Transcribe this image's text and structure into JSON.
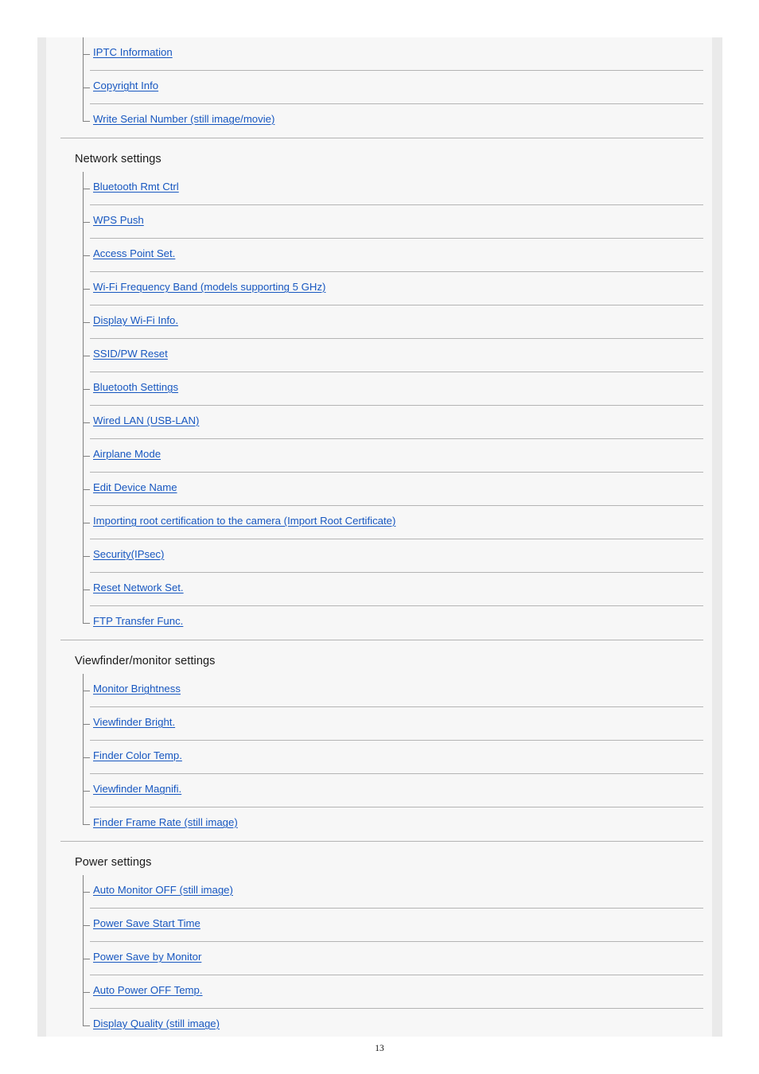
{
  "document": {
    "page_number": "13",
    "link_color": "#1757c0",
    "rule_color": "#b4b4b4",
    "page_background": "#f7f7f7"
  },
  "sections": [
    {
      "title": null,
      "items": [
        {
          "label": "IPTC Information"
        },
        {
          "label": "Copyright Info"
        },
        {
          "label": "Write Serial Number (still image/movie)"
        }
      ]
    },
    {
      "title": "Network settings",
      "items": [
        {
          "label": "Bluetooth Rmt Ctrl"
        },
        {
          "label": "WPS Push"
        },
        {
          "label": "Access Point Set."
        },
        {
          "label": "Wi-Fi Frequency Band (models supporting 5 GHz)"
        },
        {
          "label": "Display Wi-Fi Info."
        },
        {
          "label": "SSID/PW Reset"
        },
        {
          "label": "Bluetooth Settings"
        },
        {
          "label": "Wired LAN (USB-LAN)"
        },
        {
          "label": "Airplane Mode"
        },
        {
          "label": "Edit Device Name"
        },
        {
          "label": "Importing root certification to the camera (Import Root Certificate)"
        },
        {
          "label": "Security(IPsec)"
        },
        {
          "label": "Reset Network Set."
        },
        {
          "label": "FTP Transfer Func."
        }
      ]
    },
    {
      "title": "Viewfinder/monitor settings",
      "items": [
        {
          "label": "Monitor Brightness"
        },
        {
          "label": "Viewfinder Bright."
        },
        {
          "label": "Finder Color Temp."
        },
        {
          "label": "Viewfinder Magnifi."
        },
        {
          "label": "Finder Frame Rate (still image)"
        }
      ]
    },
    {
      "title": "Power settings",
      "items": [
        {
          "label": "Auto Monitor OFF (still image)"
        },
        {
          "label": "Power Save Start Time"
        },
        {
          "label": "Power Save by Monitor"
        },
        {
          "label": "Auto Power OFF Temp."
        },
        {
          "label": "Display Quality (still image)"
        }
      ]
    }
  ]
}
